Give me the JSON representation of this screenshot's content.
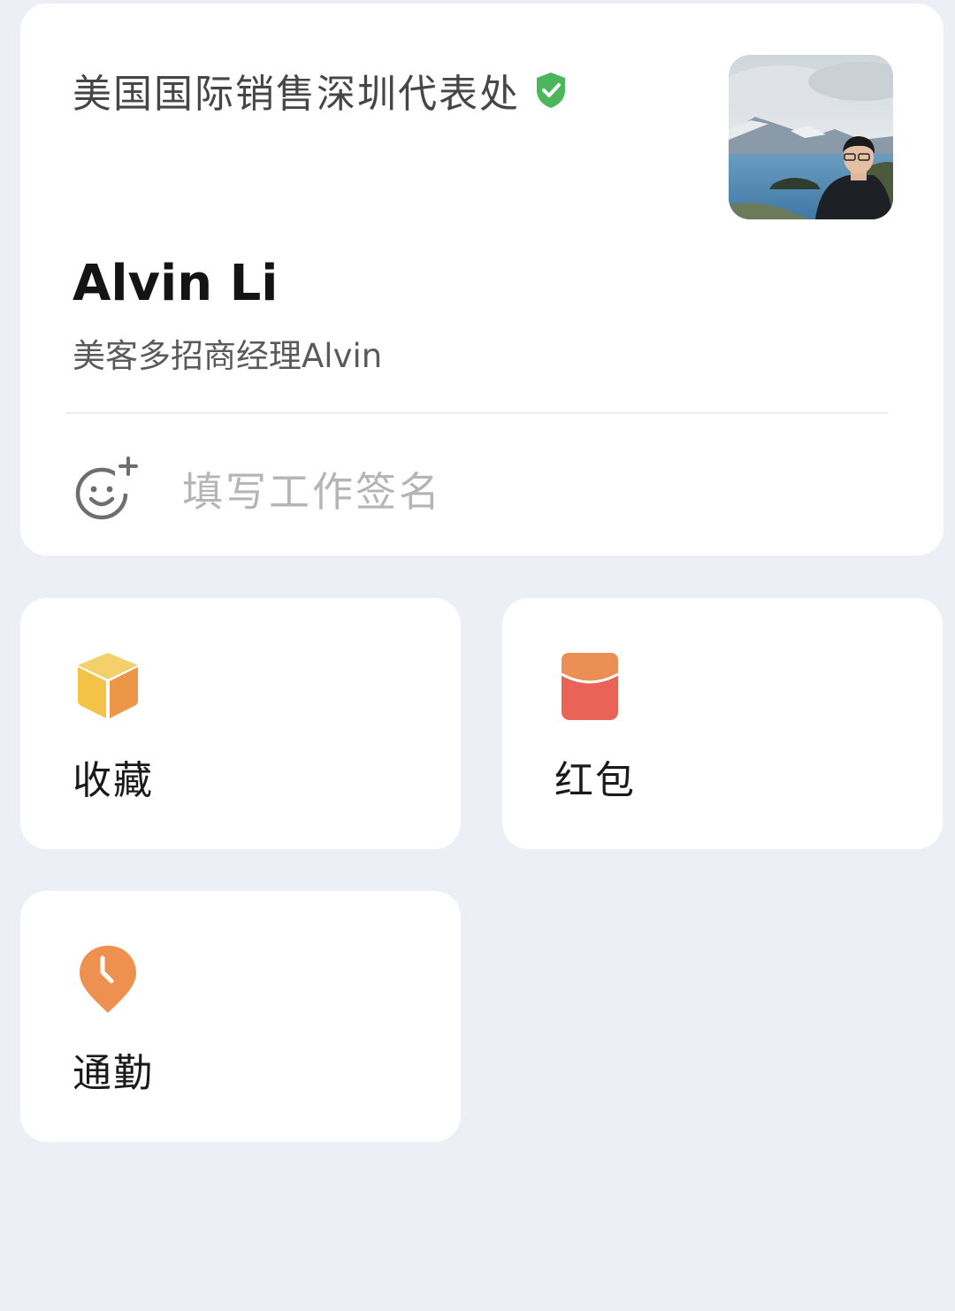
{
  "profile": {
    "organization": "美国国际销售深圳代表处",
    "verified_icon": "verified-shield-icon",
    "name": "Alvin Li",
    "title": "美客多招商经理Alvin",
    "avatar": "profile-photo",
    "signature_placeholder": "填写工作签名",
    "signature_icon": "emoji-add-icon"
  },
  "tiles": [
    {
      "label": "收藏",
      "icon": "favorites-box-icon"
    },
    {
      "label": "红包",
      "icon": "red-packet-icon"
    },
    {
      "label": "通勤",
      "icon": "commute-clock-pin-icon"
    }
  ],
  "colors": {
    "background": "#eceff6",
    "card": "#ffffff",
    "verified": "#4cb65c",
    "favorites_yellow": "#f2c54a",
    "favorites_orange": "#ec9748",
    "red_packet": "#e96456",
    "commute": "#ee9150"
  }
}
